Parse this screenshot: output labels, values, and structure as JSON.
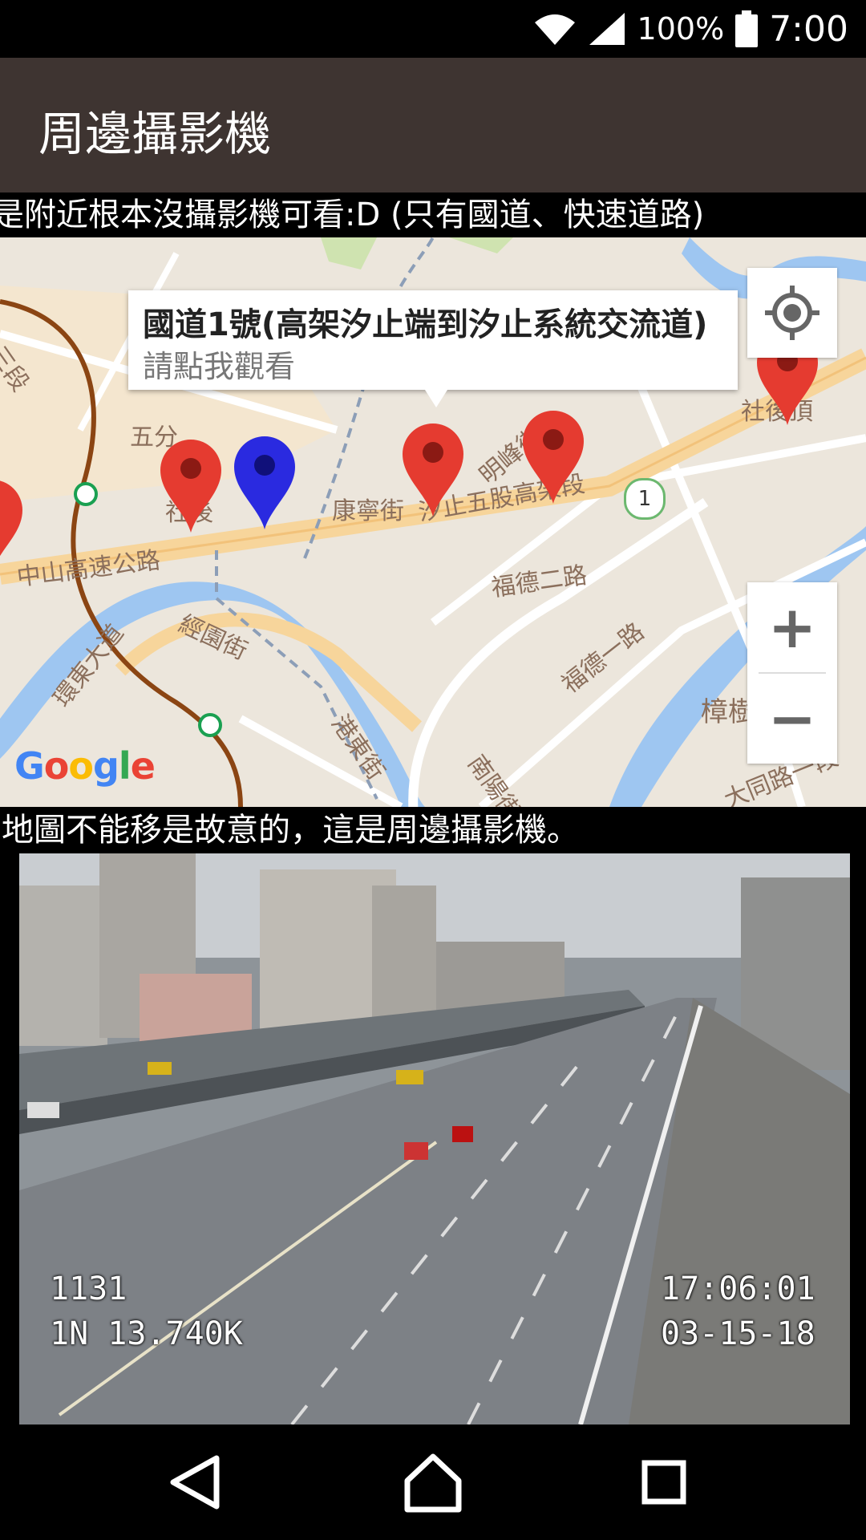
{
  "status_bar": {
    "battery_percent": "100%",
    "time": "7:00"
  },
  "app_bar": {
    "title": "周邊攝影機"
  },
  "ticker": {
    "text": "是附近根本沒攝影機可看:D (只有國道、快速道路)"
  },
  "map": {
    "info_window": {
      "title": "國道1號(高架汐止端到汐止系統交流道)",
      "subtitle": "請點我觀看"
    },
    "labels": {
      "wufen": "五分",
      "shehouding": "社後頂",
      "kangning": "康寧街",
      "xizhi_wugu": "汐止五股高架段",
      "mingfeng": "明峰街",
      "fude2": "福德二路",
      "fude1": "福德一路",
      "zhongshan_hwy": "中山高速公路",
      "jingyuan": "經園街",
      "huandong": "環東大道",
      "gangdong": "港東街",
      "nanyang": "南陽街",
      "zhangshuwan": "樟樹灣",
      "datong": "大同路一段",
      "sanduan": "三段",
      "shehou": "社後",
      "route_num": "1"
    },
    "attribution": "Google",
    "zoom_in": "+",
    "zoom_out": "−",
    "colors": {
      "marker_red": "#e53b30",
      "marker_blue": "#2a2ae0",
      "highway": "#f7d59b",
      "river": "#9ec6f1"
    }
  },
  "caption": {
    "text": "地圖不能移是故意的，這是周邊攝影機。"
  },
  "camera": {
    "id": "1131",
    "location": "1N 13.740K",
    "time": "17:06:01",
    "date": "03-15-18"
  },
  "nav_bar": {
    "icons": [
      "back-icon",
      "home-icon",
      "recents-icon"
    ]
  }
}
